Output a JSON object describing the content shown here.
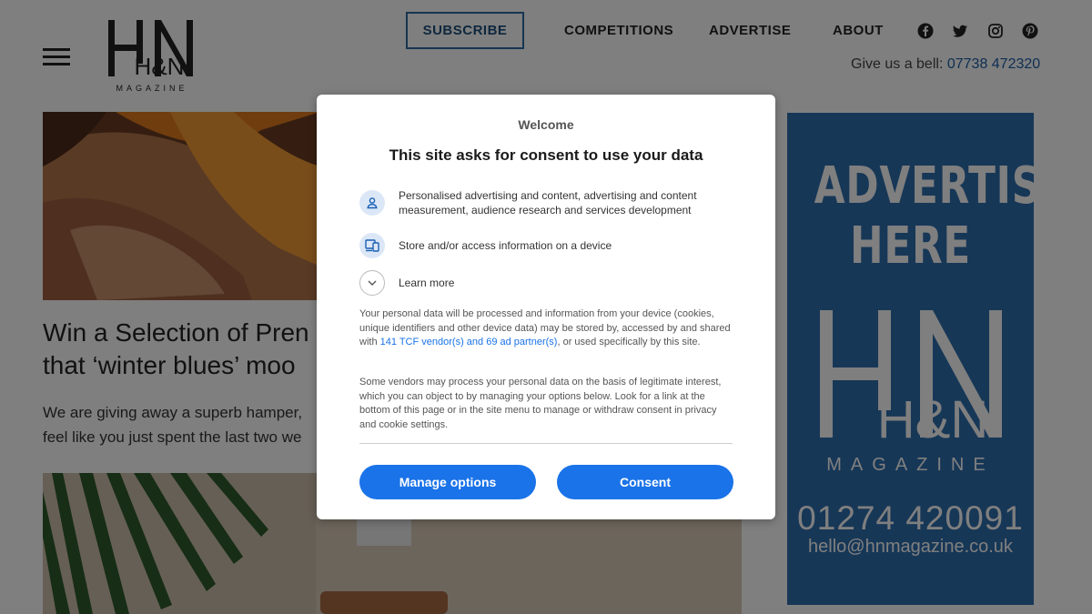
{
  "header": {
    "nav": {
      "subscribe": "SUBSCRIBE",
      "competitions": "COMPETITIONS",
      "advertise": "ADVERTISE",
      "about": "ABOUT"
    },
    "logo_text": "H&N",
    "logo_sub": "MAGAZINE",
    "social_icons": [
      "facebook-icon",
      "twitter-icon",
      "instagram-icon",
      "pinterest-icon"
    ],
    "phone_prefix": "Give us a bell:",
    "phone": "07738 472320"
  },
  "article": {
    "title_line1": "Win a Selection of Pren",
    "title_line2": "that ‘winter blues’ moo",
    "excerpt_line1": "We are giving away a superb hamper,",
    "excerpt_line2": "feel like you just spent the last two we"
  },
  "ad": {
    "headline_line1": "ADVERTISE",
    "headline_line2": "HERE",
    "logo_text": "H&N",
    "magazine": "MAGAZINE",
    "phone": "01274 420091",
    "email": "hello@hnmagazine.co.uk"
  },
  "consent": {
    "welcome": "Welcome",
    "title": "This site asks for consent to use your data",
    "purposes": [
      {
        "icon": "person-icon",
        "text": "Personalised advertising and content, advertising and content measurement, audience research and services development"
      },
      {
        "icon": "device-icon",
        "text": "Store and/or access information on a device"
      }
    ],
    "learn_more": "Learn more",
    "para1_a": "Your personal data will be processed and information from your device (cookies, unique identifiers and other device data) may be stored by, accessed by and shared with ",
    "para1_link": "141 TCF vendor(s) and 69 ad partner(s)",
    "para1_b": ", or used specifically by this site.",
    "para2": "Some vendors may process your personal data on the basis of legitimate interest, which you can object to by managing your options below. Look for a link at the bottom of this page or in the site menu to manage or withdraw consent in privacy and cookie settings.",
    "manage_button": "Manage options",
    "consent_button": "Consent"
  },
  "colors": {
    "accent": "#1a73e8",
    "ad_background": "#2f6fae",
    "overlay": "rgba(0,0,0,0.5)"
  }
}
